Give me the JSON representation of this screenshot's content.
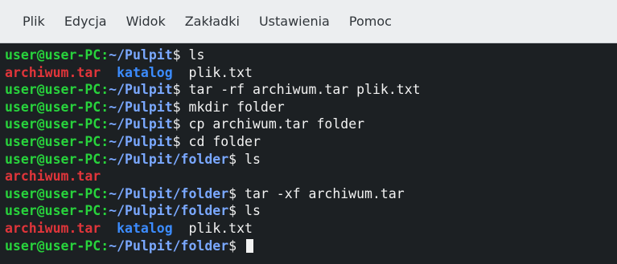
{
  "menubar": {
    "items": [
      "Plik",
      "Edycja",
      "Widok",
      "Zakładki",
      "Ustawienia",
      "Pomoc"
    ]
  },
  "terminal": {
    "prompt": "user@user-PC",
    "path_home": "~/Pulpit",
    "path_folder": "~/Pulpit/folder",
    "sigil": "$",
    "commands": [
      "ls",
      "tar -rf archiwum.tar plik.txt",
      "mkdir folder",
      "cp archiwum.tar folder",
      "cd folder",
      "ls",
      "tar -xf archiwum.tar",
      "ls"
    ],
    "output1": {
      "archive": "archiwum.tar",
      "dir": "katalog",
      "file": "plik.txt"
    },
    "output2": {
      "archive": "archiwum.tar"
    },
    "output3": {
      "archive": "archiwum.tar",
      "dir": "katalog",
      "file": "plik.txt"
    }
  },
  "colors": {
    "prompt": "#28d33c",
    "path": "#7aa8ff",
    "archive": "#e0353a",
    "directory": "#3c8cff",
    "background": "#1c2023"
  }
}
